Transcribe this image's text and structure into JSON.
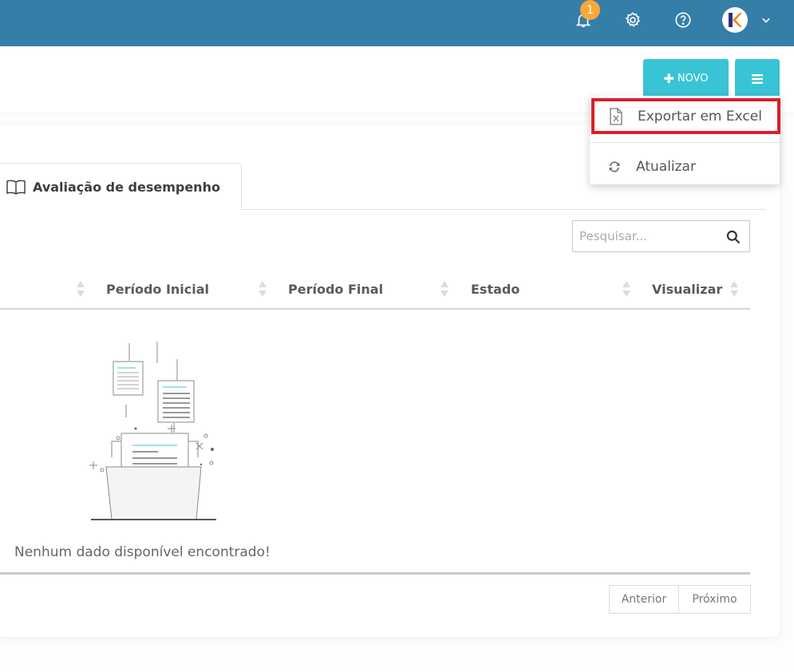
{
  "topbar": {
    "notification_count": "1",
    "icons": [
      "bell-icon",
      "gear-icon",
      "help-icon",
      "avatar",
      "chevron-down-icon"
    ],
    "avatar_letter": "K",
    "color": "#347ea8"
  },
  "toolbar": {
    "novo_label": "NOVO",
    "accent_color": "#38c4d5"
  },
  "dropdown": {
    "export_label": "Exportar em Excel",
    "refresh_label": "Atualizar",
    "highlight_color": "#d9202c"
  },
  "tabs": [
    {
      "label": "Avaliação de desempenho"
    }
  ],
  "search": {
    "placeholder": "Pesquisar..."
  },
  "table": {
    "columns": [
      "Período Inicial",
      "Período Final",
      "Estado",
      "Visualizar"
    ],
    "empty_message": "Nenhum dado disponível encontrado!"
  },
  "pagination": {
    "prev_label": "Anterior",
    "next_label": "Próximo"
  }
}
